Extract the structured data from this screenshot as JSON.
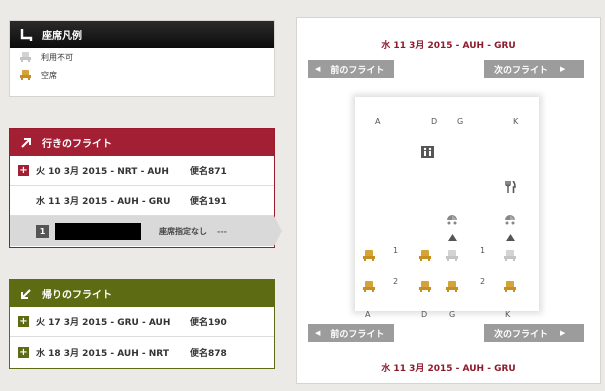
{
  "legend": {
    "title": "座席凡例",
    "items": [
      {
        "label": "利用不可",
        "status": "unavailable"
      },
      {
        "label": "空席",
        "status": "available"
      }
    ]
  },
  "outbound": {
    "title": "行きのフライト",
    "flights": [
      {
        "route": "火 10 3月 2015 - NRT - AUH",
        "flight_no": "便名871",
        "toggle": "+"
      },
      {
        "route": "水 11 3月 2015 - AUH - GRU",
        "flight_no": "便名191",
        "toggle": ""
      }
    ],
    "passenger": {
      "number": "1",
      "seat_status": "座席指定なし",
      "seat": "---"
    }
  },
  "return": {
    "title": "帰りのフライト",
    "flights": [
      {
        "route": "火 17 3月 2015 - GRU - AUH",
        "flight_no": "便名190",
        "toggle": "+"
      },
      {
        "route": "水 18 3月 2015 - AUH - NRT",
        "flight_no": "便名878",
        "toggle": "+"
      }
    ]
  },
  "seatmap": {
    "title_top": "水 11 3月 2015 - AUH - GRU",
    "title_bottom": "水 11 3月 2015 - AUH - GRU",
    "prev_label": "前のフライト",
    "next_label": "次のフライト",
    "columns_top": [
      "A",
      "D",
      "G",
      "K"
    ],
    "columns_bottom": [
      "A",
      "D",
      "G",
      "K"
    ],
    "rows": [
      {
        "number": "1",
        "seats": [
          "available",
          "available",
          "unavailable",
          "unavailable"
        ]
      },
      {
        "number": "2",
        "seats": [
          "available",
          "available",
          "available",
          "available"
        ]
      }
    ]
  },
  "colors": {
    "outbound_header": "#a31f34",
    "return_header": "#5d6b12",
    "legend_header": "#111111",
    "available_seat": "#d5a33a",
    "unavailable_seat": "#d3d3d3",
    "title_red": "#8c1c2c",
    "nav_button": "#9c9c9c"
  }
}
